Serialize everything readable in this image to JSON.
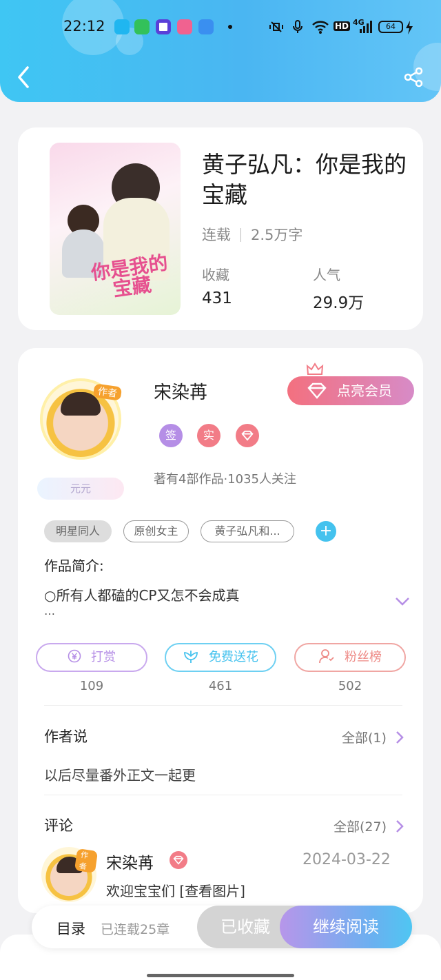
{
  "status_bar": {
    "time": "22:12",
    "network": "4G",
    "hd": "HD",
    "battery": "64"
  },
  "header": {
    "back_icon": "chevron-left-icon",
    "share_icon": "share-icon"
  },
  "book": {
    "title": "黄子弘凡：你是我的宝藏",
    "cover_text": "你是我的宝藏",
    "status": "连载",
    "word_count": "2.5万字",
    "favorites_label": "收藏",
    "favorites_value": "431",
    "popularity_label": "人气",
    "popularity_value": "29.9万"
  },
  "author": {
    "avatar_tag": "作者",
    "badge": "元元",
    "name": "宋染苒",
    "vip_button": "点亮会员",
    "level_badges": [
      {
        "label": "签",
        "color": "#b58ee6"
      },
      {
        "label": "实",
        "color": "#f27c87"
      }
    ],
    "description": "著有4部作品·1035人关注"
  },
  "tags": [
    "明星同人",
    "原创女主",
    "黄子弘凡和..."
  ],
  "intro": {
    "heading": "作品简介:",
    "text": "○所有人都磕的CP又怎不会成真",
    "ellipsis": "…"
  },
  "actions": [
    {
      "label": "打赏",
      "count": "109",
      "color": "#b58ee6",
      "icon": "yen-coin-icon"
    },
    {
      "label": "免费送花",
      "count": "461",
      "color": "#44c2ee",
      "icon": "flower-icon"
    },
    {
      "label": "粉丝榜",
      "count": "502",
      "color": "#ee8a86",
      "icon": "fan-user-icon"
    }
  ],
  "author_says": {
    "heading": "作者说",
    "more": "全部(1)",
    "text": "以后尽量番外正文一起更"
  },
  "comments": {
    "heading": "评论",
    "more": "全部(27)",
    "avatar_tag": "作者",
    "items": [
      {
        "name": "宋染苒",
        "date": "2024-03-22",
        "text": "欢迎宝宝们 [查看图片]"
      }
    ]
  },
  "bottom_bar": {
    "toc": "目录",
    "chapters": "已连载25章",
    "favorited": "已收藏",
    "continue": "继续阅读"
  }
}
